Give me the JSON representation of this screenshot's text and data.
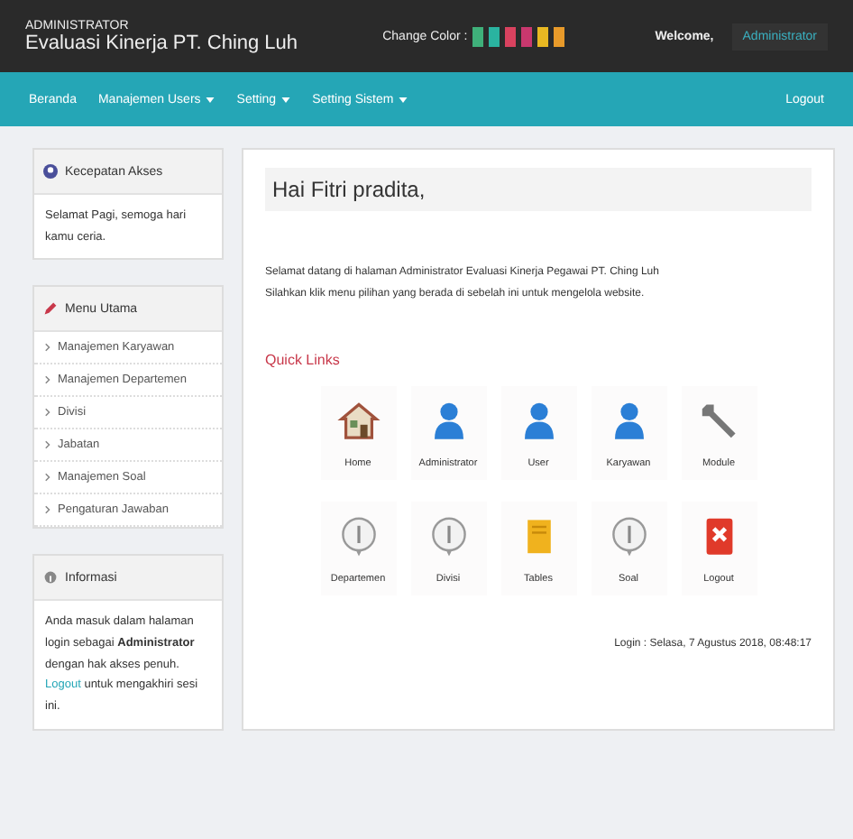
{
  "header": {
    "role": "ADMINISTRATOR",
    "title": "Evaluasi Kinerja PT. Ching Luh",
    "color_label": "Change Color :",
    "swatches": [
      {
        "color": "#3fb07a"
      },
      {
        "color": "#2ab3a0"
      },
      {
        "color": "#d9425f"
      },
      {
        "color": "#c8386e"
      },
      {
        "color": "#e8b822"
      },
      {
        "color": "#e89a2a"
      }
    ],
    "welcome": "Welcome,",
    "user_button": "Administrator"
  },
  "nav": {
    "items": [
      {
        "label": "Beranda",
        "dropdown": false
      },
      {
        "label": "Manajemen Users",
        "dropdown": true
      },
      {
        "label": "Setting",
        "dropdown": true
      },
      {
        "label": "Setting Sistem",
        "dropdown": true
      }
    ],
    "logout": "Logout"
  },
  "sidebar": [
    {
      "kind": "text",
      "title": "Kecepatan Akses",
      "text": "Selamat Pagi, semoga hari kamu ceria."
    },
    {
      "kind": "menu",
      "title": "Menu Utama",
      "items": [
        "Manajemen Karyawan",
        "Manajemen Departemen",
        "Divisi",
        "Jabatan",
        "Manajemen Soal",
        "Pengaturan Jawaban"
      ]
    },
    {
      "kind": "info",
      "title": "Informasi",
      "text": "Anda masuk dalam halaman login sebagai **Administrator**",
      "text2": "dengan hak akses penuh.",
      "link": "Logout",
      "text3": "untuk mengakhiri sesi ini."
    }
  ],
  "main": {
    "greeting": "Hai Fitri pradita,",
    "lines": [
      "Selamat datang di halaman Administrator Evaluasi Kinerja Pegawai PT. Ching Luh",
      "Silahkan klik menu pilihan yang berada di sebelah ini untuk mengelola website."
    ],
    "quick_title": "Quick Links",
    "links": [
      {
        "kind": "home",
        "label": "Home"
      },
      {
        "kind": "person",
        "label": "Administrator"
      },
      {
        "kind": "person",
        "label": "User"
      },
      {
        "kind": "person",
        "label": "Karyawan"
      },
      {
        "kind": "wrench",
        "label": "Module"
      },
      {
        "kind": "info",
        "label": "Departemen"
      },
      {
        "kind": "info",
        "label": "Divisi"
      },
      {
        "kind": "note",
        "label": "Tables"
      },
      {
        "kind": "info",
        "label": "Soal"
      },
      {
        "kind": "exit",
        "label": "Logout"
      }
    ],
    "footer": "Login : Selasa, 7 Agustus 2018, 08:48:17"
  }
}
